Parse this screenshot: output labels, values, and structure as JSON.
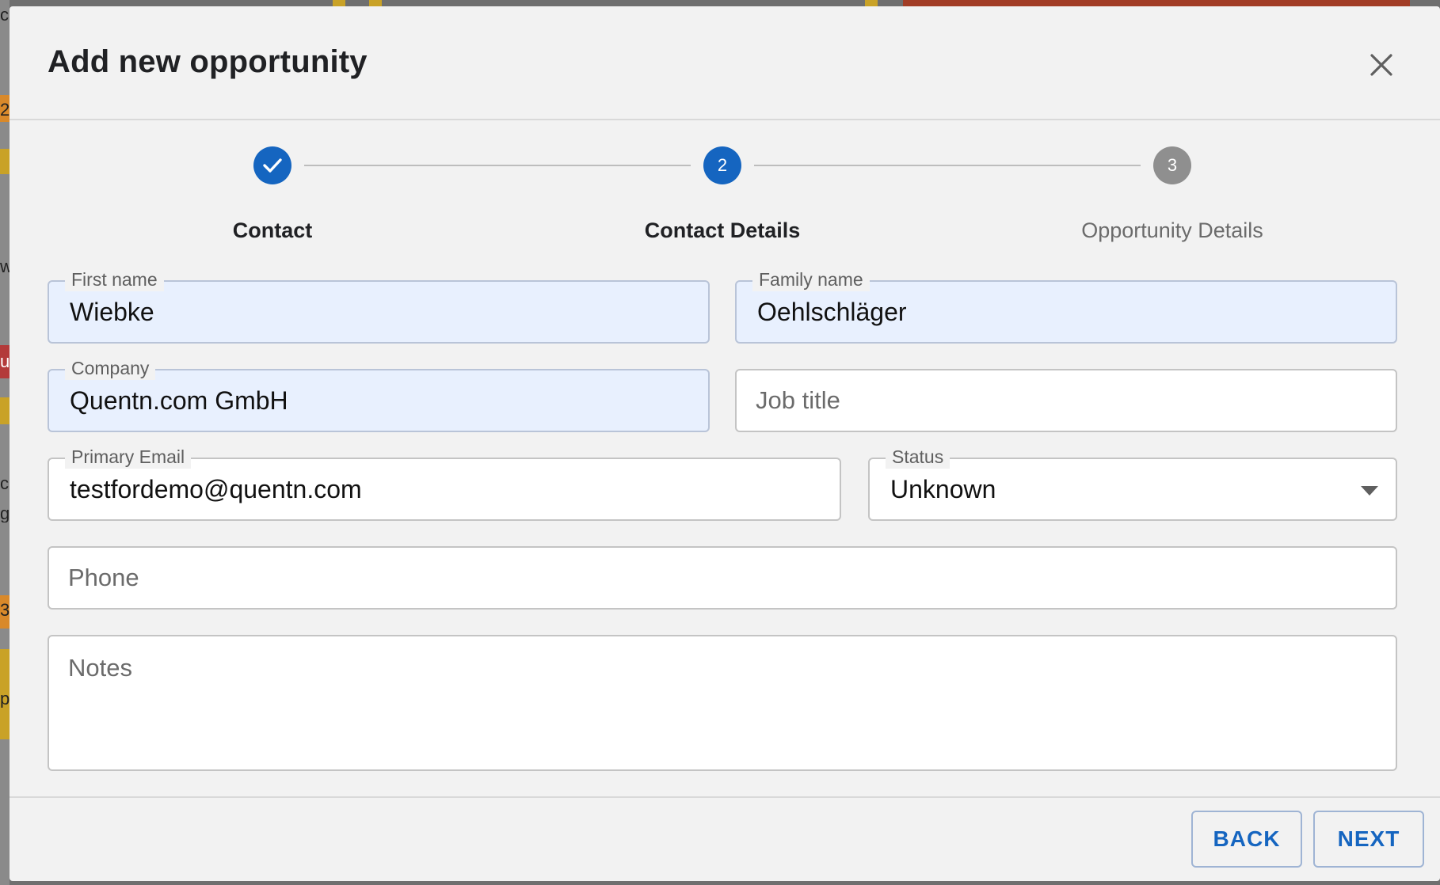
{
  "backdrop": {
    "glyphs": [
      "c",
      "2",
      "w",
      "u",
      "c",
      "g",
      "3",
      "p"
    ],
    "colors": {
      "amber": "#c9a227",
      "rust": "#a23d26",
      "red": "#b33a3a"
    }
  },
  "dialog": {
    "title": "Add new opportunity",
    "close_icon": "close-icon"
  },
  "stepper": {
    "steps": [
      {
        "label": "Contact",
        "state": "completed",
        "icon": "check-icon"
      },
      {
        "label": "Contact Details",
        "number": "2",
        "state": "active"
      },
      {
        "label": "Opportunity Details",
        "number": "3",
        "state": "inactive"
      }
    ],
    "colors": {
      "active": "#1565c0",
      "inactive": "#8f8f8f"
    }
  },
  "form": {
    "first_name": {
      "label": "First name",
      "value": "Wiebke"
    },
    "family_name": {
      "label": "Family name",
      "value": "Oehlschläger"
    },
    "company": {
      "label": "Company",
      "value": "Quentn.com GmbH"
    },
    "job_title": {
      "placeholder": "Job title",
      "value": ""
    },
    "primary_email": {
      "label": "Primary Email",
      "value": "testfordemo@quentn.com"
    },
    "status": {
      "label": "Status",
      "value": "Unknown",
      "icon": "dropdown-arrow-icon"
    },
    "phone": {
      "placeholder": "Phone",
      "value": ""
    },
    "notes": {
      "placeholder": "Notes",
      "value": ""
    }
  },
  "footer": {
    "back_label": "BACK",
    "next_label": "NEXT"
  },
  "colors": {
    "accent": "#1565c0",
    "autofill_bg": "#e8f0fe",
    "dialog_bg": "#f2f2f2"
  }
}
